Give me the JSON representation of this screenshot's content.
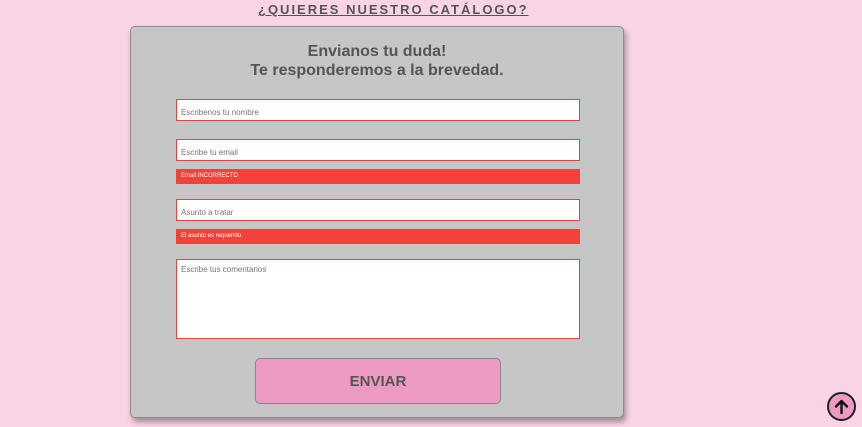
{
  "catalog_link": "¿QUIERES NUESTRO CATÁLOGO?",
  "form": {
    "title_line1": "Envianos tu duda!",
    "title_line2": "Te responderemos a la brevedad.",
    "name_placeholder": "Escribenos tu nombre",
    "email_placeholder": "Escribe tu email",
    "email_error": "Email INCORRECTO",
    "subject_placeholder": "Asunto a tratar",
    "subject_error": "El asunto es requerido",
    "comments_placeholder": "Escribe tus comentarios",
    "submit_label": "ENVIAR"
  },
  "icons": {
    "scroll_top": "arrow-up-circle-icon"
  },
  "colors": {
    "page_background": "#f9d4e6",
    "card_background": "#c6c6c6",
    "button_pink": "#ec9ac3",
    "error_red": "#f3413b"
  }
}
